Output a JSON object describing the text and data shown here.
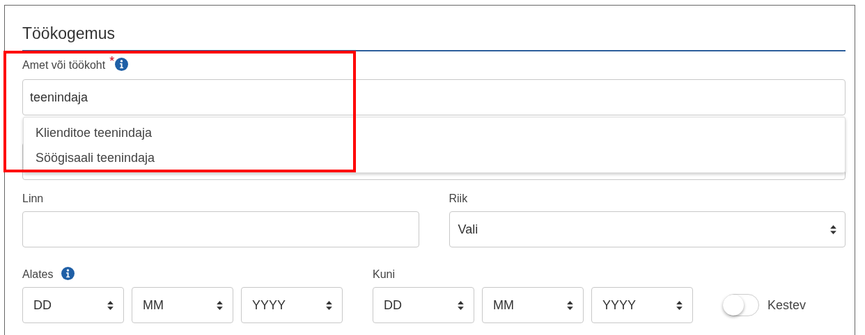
{
  "section": {
    "title": "Töökogemus"
  },
  "job_field": {
    "label": "Amet või töökoht",
    "required_mark": "*",
    "info": true,
    "value": "teenindaja",
    "highlighted": true,
    "suggestions": [
      {
        "label": "Klienditoe teenindaja"
      },
      {
        "label": "Söögisaali teenindaja"
      }
    ]
  },
  "city": {
    "label": "Linn"
  },
  "country": {
    "label": "Riik",
    "value": "Vali"
  },
  "date_from": {
    "label": "Alates",
    "info": true,
    "parts": [
      "DD",
      "MM",
      "YYYY"
    ]
  },
  "date_to": {
    "label": "Kuni",
    "parts": [
      "DD",
      "MM",
      "YYYY"
    ]
  },
  "ongoing": {
    "label": "Kestev",
    "on": false
  }
}
